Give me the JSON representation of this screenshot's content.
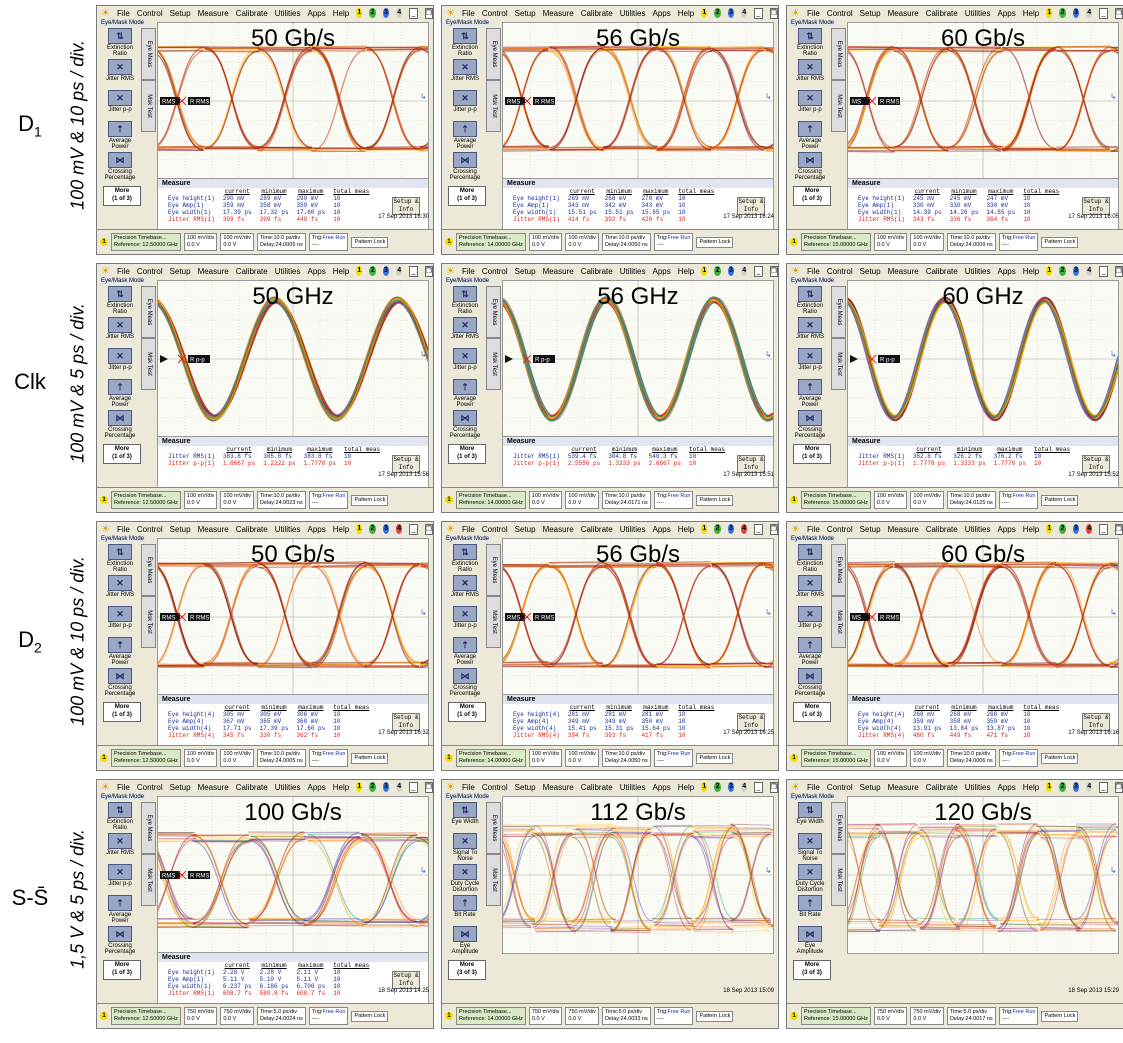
{
  "rows": [
    {
      "id": "d1",
      "label_main": "D",
      "label_sub": "1",
      "scale": "100 mV & 10 ps / div."
    },
    {
      "id": "clk",
      "label_main": "Clk",
      "label_sub": "",
      "scale": "100 mV & 5 ps / div."
    },
    {
      "id": "d2",
      "label_main": "D",
      "label_sub": "2",
      "scale": "100 mV & 10 ps / div."
    },
    {
      "id": "s",
      "label_main": "S-S̄",
      "label_sub": "",
      "scale": "1,5 V & 5 ps / div."
    }
  ],
  "menu": [
    "File",
    "Control",
    "Setup",
    "Measure",
    "Calibrate",
    "Utilities",
    "Apps",
    "Help"
  ],
  "mode_label": "Eye/Mask Mode",
  "tabs": [
    "Eye Meas",
    "Msk Test"
  ],
  "toolbar_nrz": [
    "Extinction Ratio",
    "Jitter RMS",
    "Jitter p-p",
    "Average Power",
    "Crossing Percentage"
  ],
  "toolbar_rz": [
    "Eye Width",
    "Signal To Noise",
    "Duty Cycle Distortion",
    "Bit Rate",
    "Eye Amplitude"
  ],
  "more_label": "More",
  "more_of": [
    "(1 of 3)",
    "(3 of 3)"
  ],
  "measure_title": "Measure",
  "measure_cols": [
    "current",
    "minimum",
    "maximum",
    "total meas"
  ],
  "setup_label": "Setup & Info",
  "marker_rms": "RMS",
  "marker_rrms": "R RMS",
  "marker_ms": "MS",
  "marker_rpp": "R p-p",
  "status": {
    "precision": "Precision Timebase...",
    "free_run": "Free Run",
    "trig": "Trig:",
    "pattern": "Pattern Lock",
    "dash": "----"
  },
  "panels": [
    {
      "row": "d1",
      "title": "50 Gb/s",
      "kind": "eye",
      "date": "17 Sep 2013  16:30",
      "marker": "rms2",
      "ref": "Reference: 12.50000 GHz",
      "ch": [
        "100 mV/div",
        "0.0 V",
        "100 mV/div",
        "0.0 V"
      ],
      "time": [
        "Time:10.0 ps/div",
        "Delay:24.0005 ns"
      ],
      "meas": [
        [
          "Eye height(1)",
          "290 mV",
          "289 mV",
          "290 mV",
          "10"
        ],
        [
          "Eye Amp(1)",
          "359 mV",
          "358 mV",
          "359 mV",
          "10"
        ],
        [
          "Eye width(1)",
          "17.39 ps",
          "17.32 ps",
          "17.60 ps",
          "10"
        ],
        [
          "Jitter RMS(1)",
          "399 fs",
          "399 fs",
          "448 fs",
          "10"
        ]
      ]
    },
    {
      "row": "d1",
      "title": "56 Gb/s",
      "kind": "eye",
      "date": "17 Sep 2013  16:24",
      "marker": "rms1",
      "ref": "Reference: 14.00000 GHz",
      "ch": [
        "100 mV/div",
        "0.0 V",
        "100 mV/div",
        "0.0 V"
      ],
      "time": [
        "Time:10.0 ps/div",
        "Delay:24.0050 ns"
      ],
      "meas": [
        [
          "Eye height(1)",
          "269 mV",
          "268 mV",
          "270 mV",
          "10"
        ],
        [
          "Eye Amp(1)",
          "343 mV",
          "342 mV",
          "343 mV",
          "10"
        ],
        [
          "Eye width(1)",
          "15.51 ps",
          "15.51 ps",
          "15.65 ps",
          "10"
        ],
        [
          "Jitter RMS(1)",
          "414 fs",
          "392 fs",
          "420 fs",
          "10"
        ]
      ]
    },
    {
      "row": "d1",
      "title": "60 Gb/s",
      "kind": "eye",
      "date": "17 Sep 2013  16:05",
      "marker": "ms",
      "ref": "Reference: 15.00000 GHz",
      "ch": [
        "100 mV/div",
        "0.0 V",
        "100 mV/div",
        "0.0 V"
      ],
      "time": [
        "Time:10.0 ps/div",
        "Delay:24.0009 ns"
      ],
      "meas": [
        [
          "Eye height(1)",
          "245 mV",
          "245 mV",
          "247 mV",
          "10"
        ],
        [
          "Eye Amp(1)",
          "330 mV",
          "330 mV",
          "330 mV",
          "10"
        ],
        [
          "Eye width(1)",
          "14.39 ps",
          "14.26 ps",
          "14.55 ps",
          "10"
        ],
        [
          "Jitter RMS(1)",
          "343 fs",
          "336 fs",
          "364 fs",
          "10"
        ]
      ]
    },
    {
      "row": "clk",
      "title": "50 GHz",
      "kind": "sine",
      "cycles": 2.2,
      "date": "17 Sep 2013  15:56",
      "marker": "rpp",
      "ref": "Reference: 12.50000 GHz",
      "ch": [
        "100 mV/div",
        "0.0 V",
        "100 mV/div",
        "0.0 V"
      ],
      "time": [
        "Time:10.0 ps/div",
        "Delay:24.0023 ns"
      ],
      "meas": [
        [
          "Jitter RMS(1)",
          "383.8 fs",
          "305.8 fs",
          "383.8 fs",
          "10"
        ],
        [
          "Jitter p-p(1)",
          "1.8667 ps",
          "1.2222 ps",
          "1.7778 ps",
          "10"
        ]
      ]
    },
    {
      "row": "clk",
      "title": "56 GHz",
      "kind": "sine",
      "cycles": 2.5,
      "date": "17 Sep 2013  15:51",
      "marker": "rpp",
      "ref": "Reference: 14.00000 GHz",
      "ch": [
        "100 mV/div",
        "0.0 V",
        "100 mV/div",
        "0.0 V"
      ],
      "time": [
        "Time:10.0 ps/div",
        "Delay:24.0171 ns"
      ],
      "meas": [
        [
          "Jitter RMS(1)",
          "539.4 fs",
          "304.8 fs",
          "540.3 fs",
          "10"
        ],
        [
          "Jitter p-p(1)",
          "2.5556 ps",
          "1.3333 ps",
          "2.6667 ps",
          "10"
        ]
      ]
    },
    {
      "row": "clk",
      "title": "60 GHz",
      "kind": "sine",
      "cycles": 2.7,
      "date": "17 Sep 2013  15:52",
      "marker": "rpp",
      "ref": "Reference: 15.00000 GHz",
      "ch": [
        "100 mV/div",
        "0.0 V",
        "100 mV/div",
        "0.0 V"
      ],
      "time": [
        "Time:10.0 ps/div",
        "Delay:24.0125 ns"
      ],
      "meas": [
        [
          "Jitter RMS(1)",
          "362.8 fs",
          "326.2 fs",
          "376.2 fs",
          "10"
        ],
        [
          "Jitter p-p(1)",
          "1.7778 ps",
          "1.3333 ps",
          "1.7778 ps",
          "10"
        ]
      ]
    },
    {
      "row": "d2",
      "title": "50 Gb/s",
      "kind": "eye",
      "date": "17 Sep 2013  16:32",
      "marker": "rms2",
      "ref": "Reference: 12.50000 GHz",
      "ch": [
        "100 mV/div",
        "0.0 V",
        "100 mV/div",
        "0.0 V"
      ],
      "time": [
        "Time:10.0 ps/div",
        "Delay:24.0005 ns"
      ],
      "meas": [
        [
          "Eye height(4)",
          "305 mV",
          "305 mV",
          "306 mV",
          "10"
        ],
        [
          "Eye Amp(4)",
          "367 mV",
          "365 mV",
          "368 mV",
          "10"
        ],
        [
          "Eye width(4)",
          "17.71 ps",
          "17.39 ps",
          "17.60 ps",
          "10"
        ],
        [
          "Jitter RMS(4)",
          "345 fs",
          "330 fs",
          "362 fs",
          "10"
        ]
      ]
    },
    {
      "row": "d2",
      "title": "56 Gb/s",
      "kind": "eye",
      "date": "17 Sep 2013  16:25",
      "marker": "rms2",
      "ref": "Reference: 14.00000 GHz",
      "ch": [
        "100 mV/div",
        "0.0 V",
        "100 mV/div",
        "0.0 V"
      ],
      "time": [
        "Time:10.0 ps/div",
        "Delay:24.0050 ns"
      ],
      "meas": [
        [
          "Eye height(4)",
          "281 mV",
          "281 mV",
          "281 mV",
          "10"
        ],
        [
          "Eye Amp(4)",
          "349 mV",
          "349 mV",
          "350 mV",
          "10"
        ],
        [
          "Eye width(4)",
          "15.41 ps",
          "15.31 ps",
          "15.64 ps",
          "10"
        ],
        [
          "Jitter RMS(4)",
          "394 fs",
          "393 fs",
          "417 fs",
          "10"
        ]
      ]
    },
    {
      "row": "d2",
      "title": "60 Gb/s",
      "kind": "eye",
      "date": "17 Sep 2013  16:16",
      "marker": "ms",
      "ref": "Reference: 15.00000 GHz",
      "ch": [
        "100 mV/div",
        "0.0 V",
        "100 mV/div",
        "0.0 V"
      ],
      "time": [
        "Time:10.0 ps/div",
        "Delay:24.0006 ns"
      ],
      "meas": [
        [
          "Eye height(4)",
          "268 mV",
          "268 mV",
          "268 mV",
          "10"
        ],
        [
          "Eye Amp(4)",
          "359 mV",
          "358 mV",
          "359 mV",
          "10"
        ],
        [
          "Eye width(4)",
          "13.91 ps",
          "13.84 ps",
          "13.87 ps",
          "10"
        ],
        [
          "Jitter RMS(4)",
          "460 fs",
          "449 fs",
          "471 fs",
          "10"
        ]
      ]
    },
    {
      "row": "s",
      "title": "100 Gb/s",
      "kind": "eye2",
      "date": "18 Sep 2013  14:25",
      "marker": "rms2",
      "ref": "Reference: 12.50000 GHz",
      "ch": [
        "750 mV/div",
        "0.0 V",
        "750 mV/div",
        "0.0 V"
      ],
      "time": [
        "Time:5.0 ps/div",
        "Delay:24.0024 ns"
      ],
      "meas": [
        [
          "Eye height(1)",
          "2.28 V",
          "2.28 V",
          "2.11 V",
          "10"
        ],
        [
          "Eye Amp(1)",
          "5.11 V",
          "5.10 V",
          "5.11 V",
          "10"
        ],
        [
          "Eye width(1)",
          "6.237 ps",
          "6.186 ps",
          "6.706 ps",
          "10"
        ],
        [
          "Jitter RMS(1)",
          "608.7 fs",
          "580.8 fs",
          "608.7 fs",
          "10"
        ]
      ]
    },
    {
      "row": "s",
      "title": "112 Gb/s",
      "kind": "eye3",
      "date": "18 Sep 2013  15:09",
      "marker": "none",
      "ref": "Reference: 14.00000 GHz",
      "ch": [
        "750 mV/div",
        "0.0 V",
        "750 mV/div",
        "0.0 V"
      ],
      "time": [
        "Time:5.0 ps/div",
        "Delay:24.0033 ns"
      ],
      "meas": []
    },
    {
      "row": "s",
      "title": "120 Gb/s",
      "kind": "eye3",
      "date": "18 Sep 2013  15:29",
      "marker": "none",
      "ref": "Reference: 15.00000 GHz",
      "ch": [
        "750 mV/div",
        "0.0 V",
        "750 mV/div",
        "0.0 V"
      ],
      "time": [
        "Time:5.0 ps/div",
        "Delay:24.0017 ns"
      ],
      "meas": []
    }
  ]
}
